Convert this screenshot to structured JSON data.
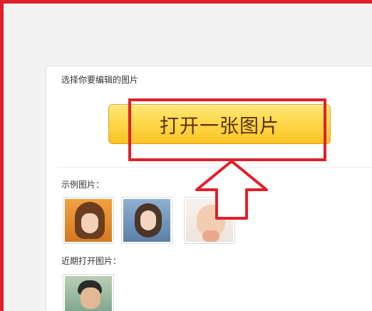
{
  "page": {
    "section_title": "选择你要编辑的图片",
    "open_button_label": "打开一张图片",
    "examples_label": "示例图片：",
    "recent_label": "近期打开图片："
  },
  "examples": [
    {
      "name": "example-photo-1"
    },
    {
      "name": "example-photo-2"
    },
    {
      "name": "example-photo-3"
    }
  ],
  "recent": [
    {
      "name": "recent-photo-1"
    }
  ],
  "colors": {
    "annotation_red": "#e0202a",
    "button_yellow": "#ffd94d",
    "button_text": "#5b3310"
  }
}
